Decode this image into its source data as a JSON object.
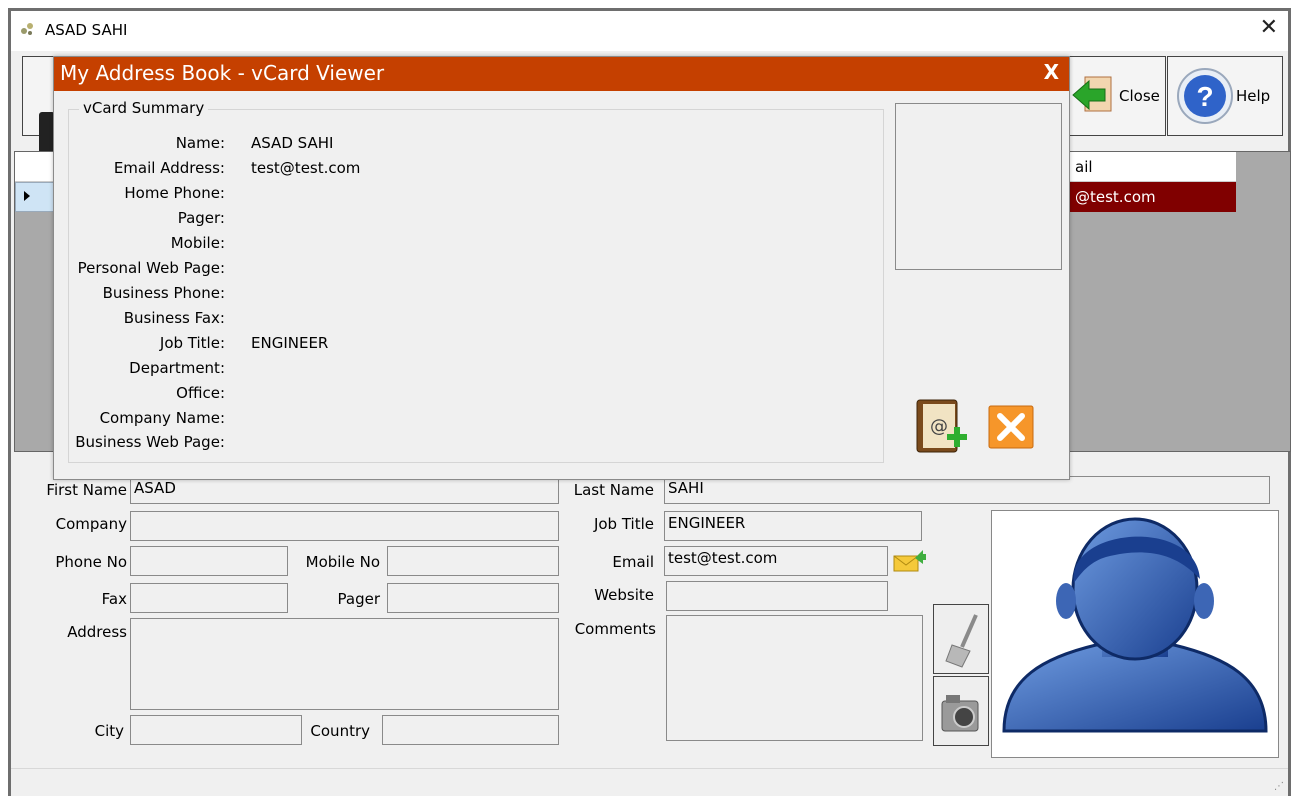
{
  "window": {
    "title": "ASAD SAHI",
    "close_glyph": "✕"
  },
  "toolbar": {
    "close_label": "Close",
    "help_label": "Help"
  },
  "grid": {
    "column_email_partial": "ail",
    "row_email_partial": "@test.com"
  },
  "form": {
    "first_name_label": "First Name",
    "first_name": "ASAD",
    "last_name_label": "Last Name",
    "last_name": "SAHI",
    "company_label": "Company",
    "company": "",
    "job_title_label": "Job Title",
    "job_title": "ENGINEER",
    "phone_label": "Phone No",
    "phone": "",
    "mobile_label": "Mobile No",
    "mobile": "",
    "email_label": "Email",
    "email": "test@test.com",
    "fax_label": "Fax",
    "fax": "",
    "pager_label": "Pager",
    "pager": "",
    "website_label": "Website",
    "website": "",
    "address_label": "Address",
    "address": "",
    "comments_label": "Comments",
    "comments": "",
    "city_label": "City",
    "city": "",
    "country_label": "Country",
    "country": ""
  },
  "modal": {
    "title": "My Address Book - vCard Viewer",
    "close_glyph": "X",
    "group_title": "vCard Summary",
    "fields": [
      {
        "label": "Name:",
        "value": "ASAD SAHI"
      },
      {
        "label": "Email Address:",
        "value": "test@test.com"
      },
      {
        "label": "Home Phone:",
        "value": ""
      },
      {
        "label": "Pager:",
        "value": ""
      },
      {
        "label": "Mobile:",
        "value": ""
      },
      {
        "label": "Personal Web Page:",
        "value": ""
      },
      {
        "label": "Business Phone:",
        "value": ""
      },
      {
        "label": "Business Fax:",
        "value": ""
      },
      {
        "label": "Job Title:",
        "value": "ENGINEER"
      },
      {
        "label": "Department:",
        "value": ""
      },
      {
        "label": "Office:",
        "value": ""
      },
      {
        "label": "Company Name:",
        "value": ""
      },
      {
        "label": "Business Web Page:",
        "value": ""
      }
    ]
  },
  "icons": {
    "app": "app-logo-icon",
    "close": "close-arrow-icon",
    "help": "help-question-icon",
    "send_email": "send-email-icon",
    "clear": "broom-icon",
    "camera": "camera-icon",
    "add_contact": "add-contact-icon",
    "cancel": "cancel-x-icon",
    "avatar": "user-avatar-icon"
  },
  "colors": {
    "modal_title_bg": "#c54000",
    "selected_row_bg": "#800000",
    "grid_bg": "#a9a9a9",
    "avatar_blue": "#2f5fb0"
  }
}
